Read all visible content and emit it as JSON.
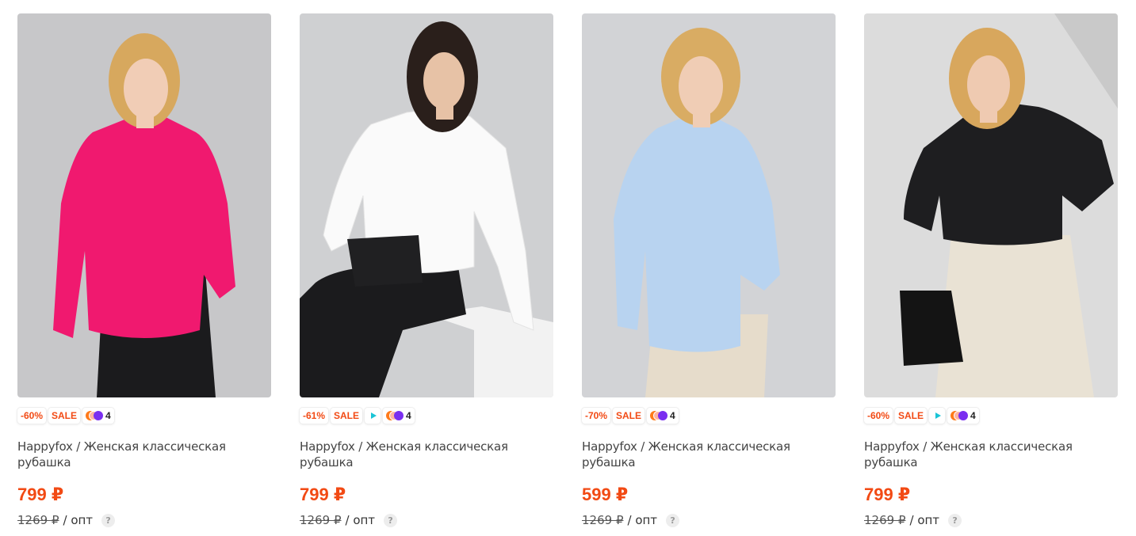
{
  "products": [
    {
      "discount": "-60%",
      "sale": "SALE",
      "has_video": false,
      "dolyami_count": "4",
      "title": "Happyfox / Женская классическая рубашка",
      "price": "799 ₽",
      "old_price": "1269 ₽",
      "opt_label": "/ опт",
      "help": "?",
      "shirt_color": "#f0196f",
      "bg_color": "#c7c7c9"
    },
    {
      "discount": "-61%",
      "sale": "SALE",
      "has_video": true,
      "dolyami_count": "4",
      "title": "Happyfox / Женская классическая рубашка",
      "price": "799 ₽",
      "old_price": "1269 ₽",
      "opt_label": "/ опт",
      "help": "?",
      "shirt_color": "#fafafa",
      "bg_color": "#cfd0d2"
    },
    {
      "discount": "-70%",
      "sale": "SALE",
      "has_video": false,
      "dolyami_count": "4",
      "title": "Happyfox / Женская классическая рубашка",
      "price": "599 ₽",
      "old_price": "1269 ₽",
      "opt_label": "/ опт",
      "help": "?",
      "shirt_color": "#b8d3f0",
      "bg_color": "#d2d3d6"
    },
    {
      "discount": "-60%",
      "sale": "SALE",
      "has_video": true,
      "dolyami_count": "4",
      "title": "Happyfox / Женская классическая рубашка",
      "price": "799 ₽",
      "old_price": "1269 ₽",
      "opt_label": "/ опт",
      "help": "?",
      "shirt_color": "#1e1e20",
      "bg_color": "#dcdcdc"
    }
  ]
}
